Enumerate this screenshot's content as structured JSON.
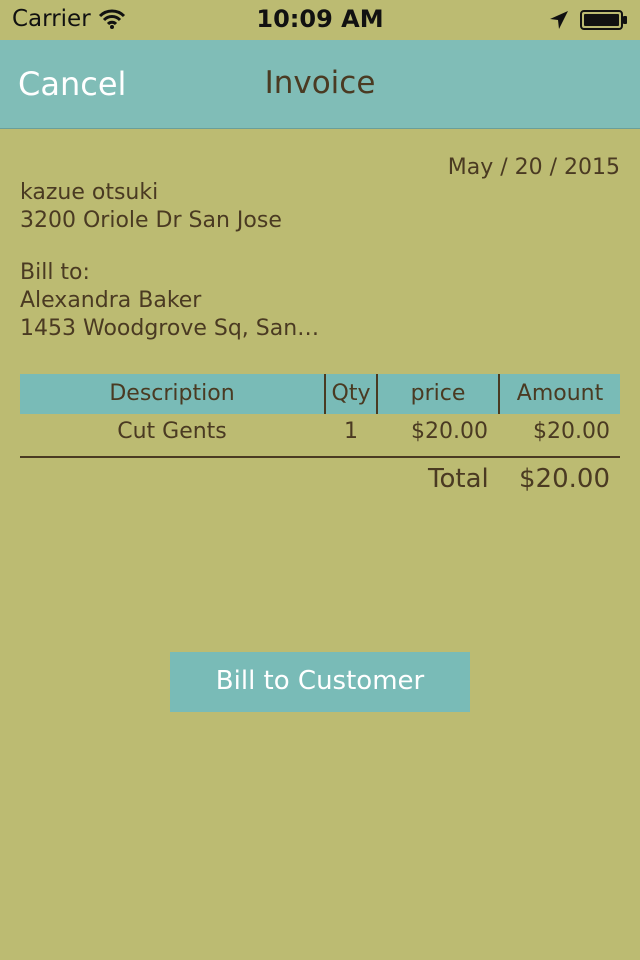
{
  "status_bar": {
    "carrier": "Carrier",
    "time": "10:09 AM"
  },
  "navbar": {
    "cancel_label": "Cancel",
    "title": "Invoice"
  },
  "invoice": {
    "date": "May / 20 / 2015",
    "from_name": "kazue otsuki",
    "from_address": "3200 Oriole Dr San Jose",
    "bill_to_label": "Bill to:",
    "bill_to_name": "Alexandra Baker",
    "bill_to_address": "1453 Woodgrove Sq, San…"
  },
  "table": {
    "headers": [
      "Description",
      "Qty",
      "price",
      "Amount"
    ],
    "rows": [
      {
        "description": "Cut Gents",
        "qty": "1",
        "price": "$20.00",
        "amount": "$20.00"
      }
    ],
    "total_label": "Total",
    "total_value": "$20.00"
  },
  "actions": {
    "bill_button_label": "Bill to Customer"
  },
  "colors": {
    "background": "#bcbb72",
    "navbar": "#80bdb7",
    "accent": "#79bbb7",
    "text": "#4a3a22"
  }
}
